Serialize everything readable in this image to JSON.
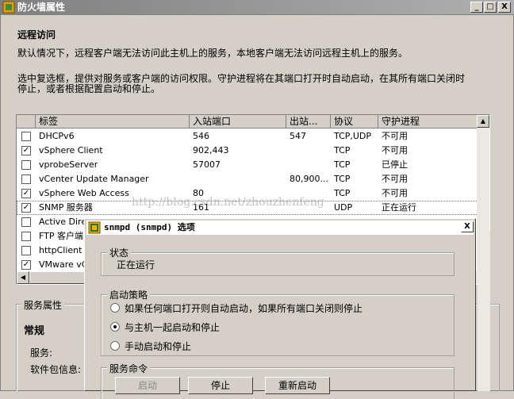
{
  "window": {
    "title": "防火墙属性",
    "minimize": "_",
    "maximize": "□",
    "close": "X"
  },
  "remote_access": {
    "heading": "远程访问",
    "line1": "默认情况下，远程客户端无法访问此主机上的服务，本地客户端无法访问远程主机上的服务。",
    "line2": "选中复选框，提供对服务或客户端的访问权限。守护进程将在其端口打开时自动启动，在其所有端口关闭时",
    "line3": "停止，或者根据配置启动和停止。"
  },
  "table": {
    "headers": [
      "标签",
      "入站端口",
      "出站...",
      "协议",
      "守护进程"
    ],
    "rows": [
      {
        "checked": false,
        "label": "DHCPv6",
        "in": "546",
        "out": "547",
        "proto": "TCP,UDP",
        "daemon": "不可用"
      },
      {
        "checked": true,
        "label": "vSphere Client",
        "in": "902,443",
        "out": "",
        "proto": "TCP",
        "daemon": "不可用"
      },
      {
        "checked": false,
        "label": "vprobeServer",
        "in": "57007",
        "out": "",
        "proto": "TCP",
        "daemon": "已停止"
      },
      {
        "checked": false,
        "label": "vCenter Update Manager",
        "in": "",
        "out": "80,900...",
        "proto": "TCP",
        "daemon": "不可用"
      },
      {
        "checked": true,
        "label": "vSphere Web Access",
        "in": "80",
        "out": "",
        "proto": "TCP",
        "daemon": "不可用"
      },
      {
        "checked": true,
        "label": "SNMP 服务器",
        "in": "161",
        "out": "",
        "proto": "UDP",
        "daemon": "正在运行"
      },
      {
        "checked": false,
        "label": "Active Direc",
        "in": "",
        "out": "",
        "proto": "",
        "daemon": ""
      },
      {
        "checked": false,
        "label": "FTP 客户端",
        "in": "",
        "out": "",
        "proto": "",
        "daemon": ""
      },
      {
        "checked": false,
        "label": "httpClient",
        "in": "",
        "out": "",
        "proto": "",
        "daemon": ""
      },
      {
        "checked": true,
        "label": "VMware vC",
        "in": "",
        "out": "",
        "proto": "",
        "daemon": ""
      }
    ]
  },
  "service_props": {
    "group_label": "服务属性",
    "general": "常规",
    "service_label": "服务:",
    "package_label": "软件包信息:"
  },
  "watermark": "http://blog.csdn.net/zhouzhenfeng",
  "dialog": {
    "title": "snmpd (snmpd) 选项",
    "close": "X",
    "status_label": "状态",
    "status_value": "正在运行",
    "policy_label": "启动策略",
    "policy_options": [
      {
        "label": "如果任何端口打开则自动启动，如果所有端口关闭则停止",
        "selected": false
      },
      {
        "label": "与主机一起启动和停止",
        "selected": true
      },
      {
        "label": "手动启动和停止",
        "selected": false
      }
    ],
    "commands_label": "服务命令",
    "start_label": "启动",
    "stop_label": "停止",
    "restart_label": "重新启动"
  },
  "colors": {
    "titlebar": "#8f8f8f",
    "face": "#d4d0c8",
    "dialog_title_bg": "#ffffff"
  }
}
